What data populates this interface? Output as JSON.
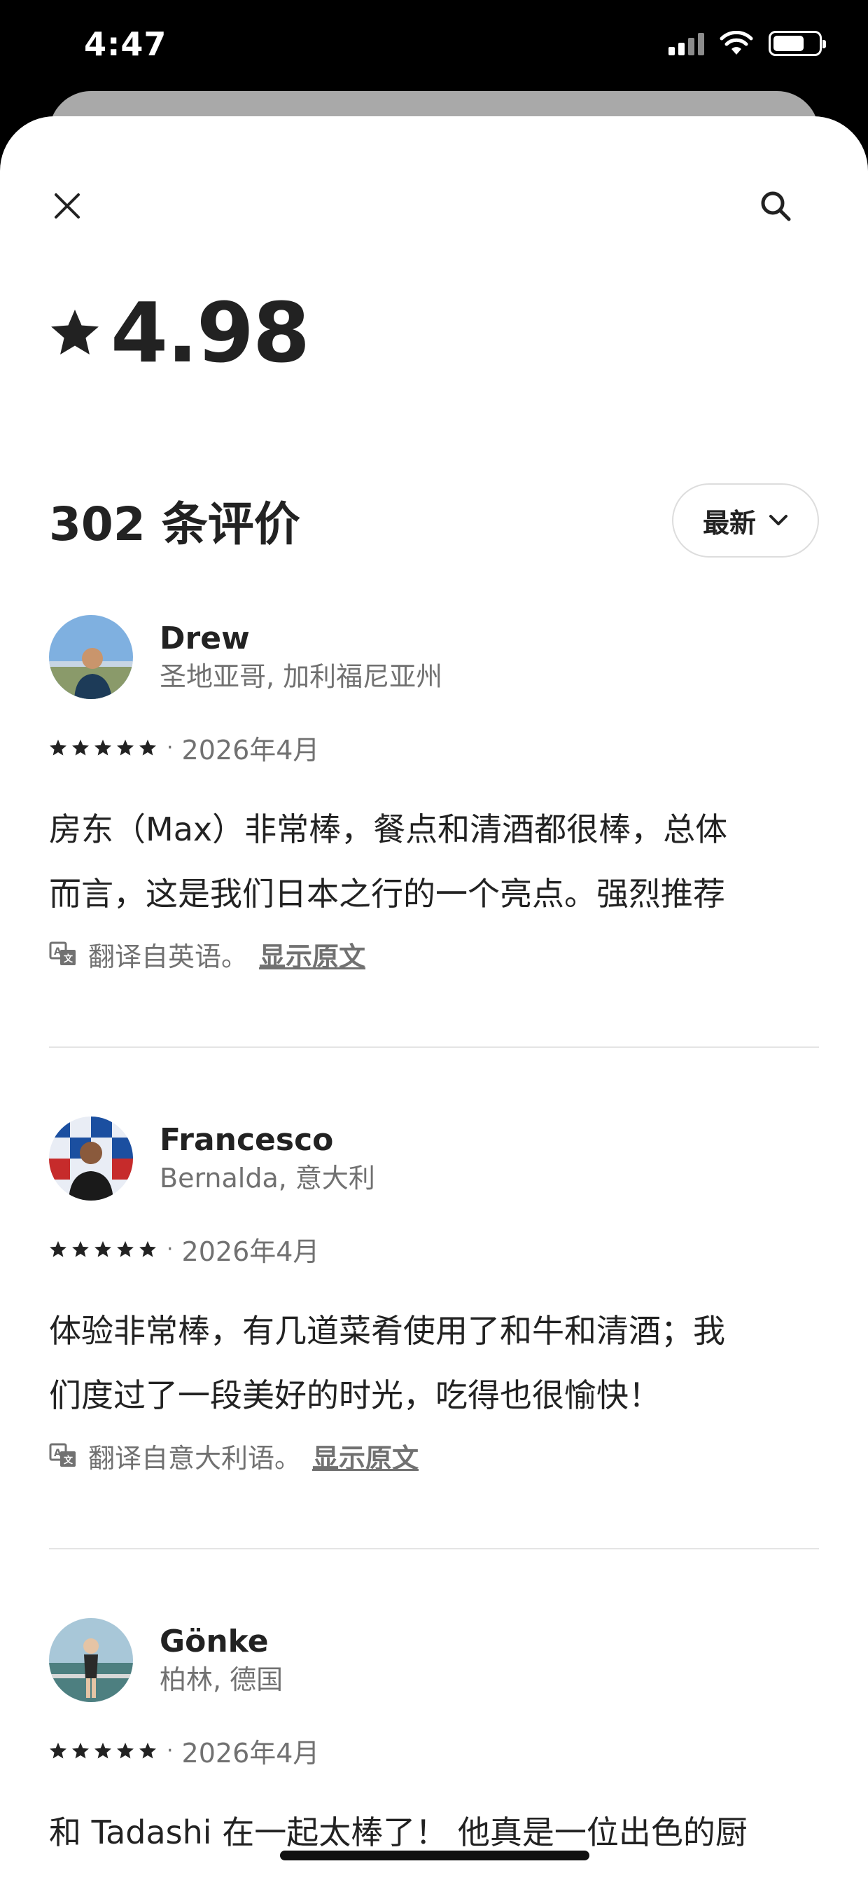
{
  "status_bar": {
    "time": "4:47",
    "icons": [
      "signal-icon",
      "wifi-icon",
      "battery-icon"
    ]
  },
  "header": {
    "close_icon": "close-icon",
    "search_icon": "search-icon"
  },
  "summary": {
    "rating": "4.98",
    "review_count_label": "302 条评价",
    "sort_label": "最新"
  },
  "reviews": [
    {
      "name": "Drew",
      "location": "圣地亚哥, 加利福尼亚州",
      "stars": 5,
      "separator": "·",
      "date": "2026年4月",
      "text_line_1": "房东（Max）非常棒，餐点和清酒都很棒，总体",
      "text_line_2": "而言，这是我们日本之行的一个亮点。强烈推荐",
      "translation_note": "翻译自英语。",
      "show_original": "显示原文"
    },
    {
      "name": "Francesco",
      "location": "Bernalda, 意大利",
      "stars": 5,
      "separator": "·",
      "date": "2026年4月",
      "text_line_1": "体验非常棒，有几道菜肴使用了和牛和清酒；我",
      "text_line_2": "们度过了一段美好的时光，吃得也很愉快！",
      "translation_note": "翻译自意大利语。",
      "show_original": "显示原文"
    },
    {
      "name": "Gönke",
      "location": "柏林, 德国",
      "stars": 5,
      "separator": "·",
      "date": "2026年4月",
      "text_line_1": "和 Tadashi 在一起太棒了！ 他真是一位出色的厨"
    }
  ],
  "colors": {
    "text_primary": "#222222",
    "text_secondary": "#717171",
    "divider": "#e4e4e4"
  }
}
